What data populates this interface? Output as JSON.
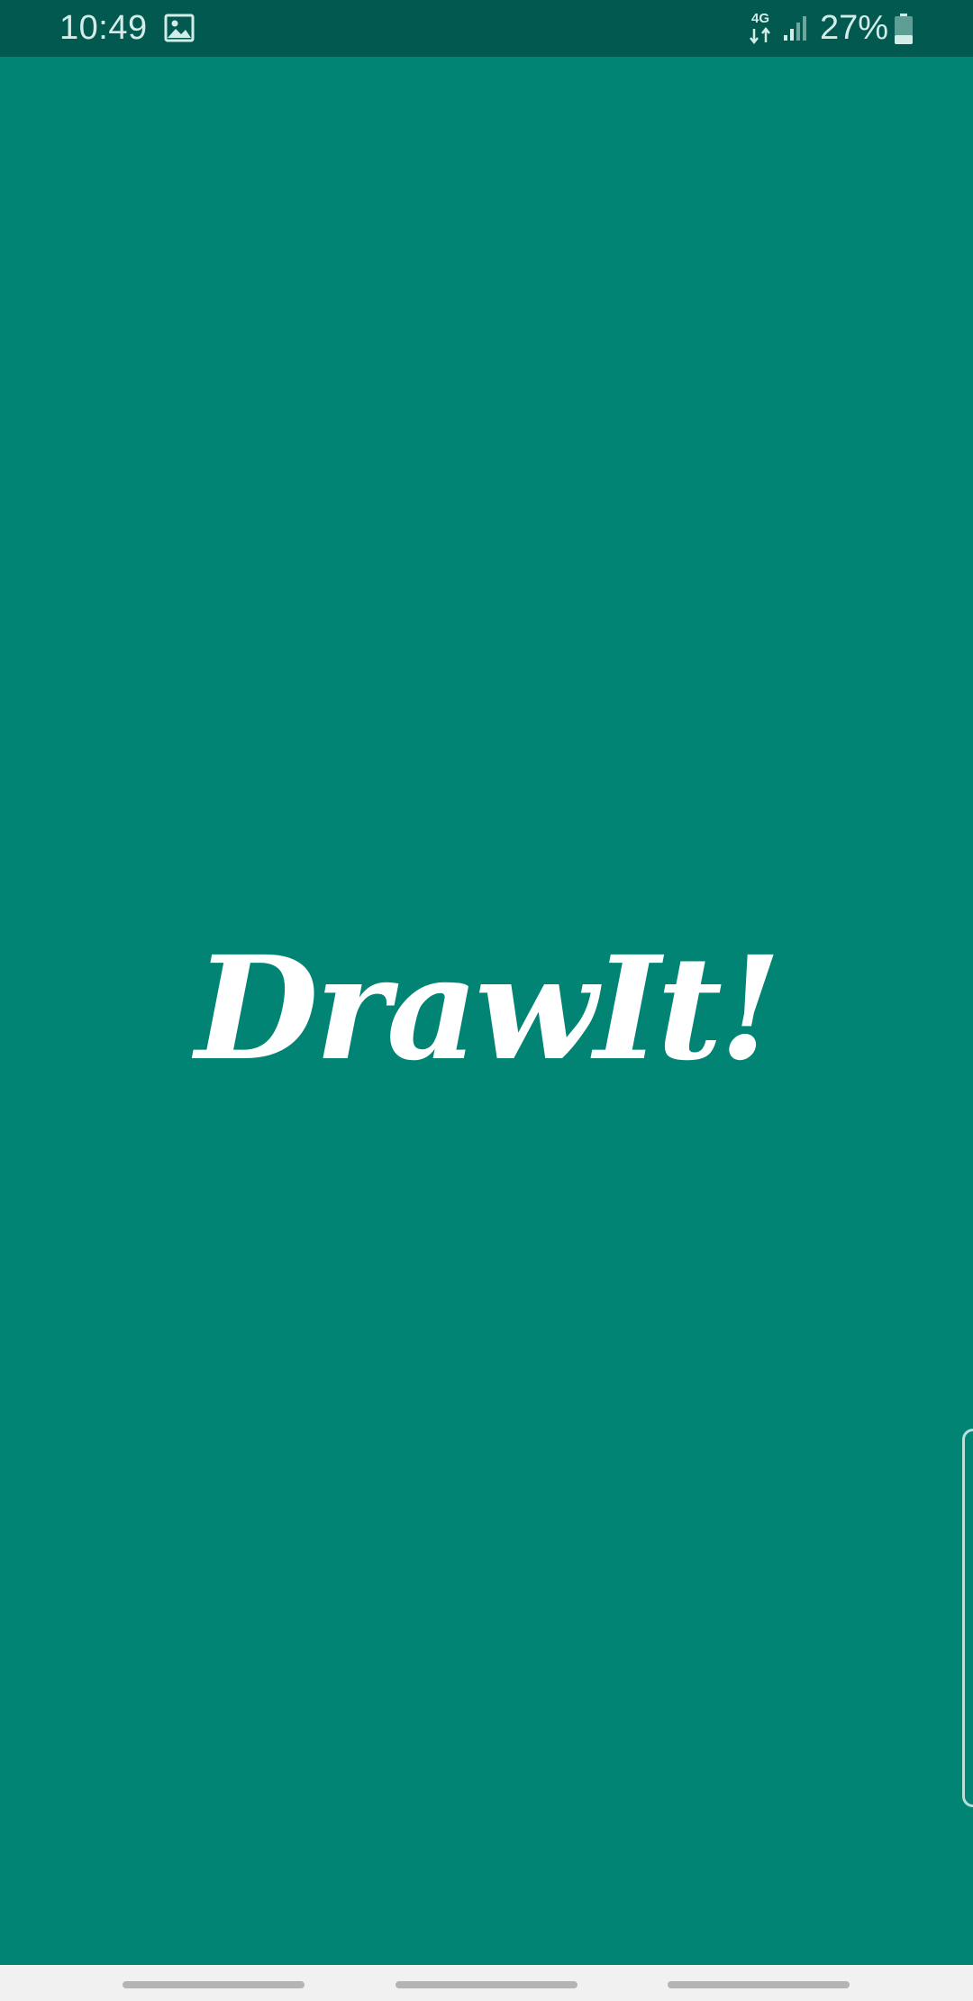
{
  "status_bar": {
    "time": "10:49",
    "network_type": "4G",
    "battery_percent": "27%",
    "battery_level": 0.27,
    "background_color": "#01594F",
    "icons": [
      "gallery-icon",
      "network-arrows-icon",
      "signal-icon",
      "battery-icon"
    ]
  },
  "splash": {
    "app_name": "DrawIt!",
    "background_color": "#028475",
    "text_color": "#FFFFFF"
  },
  "nav_bar": {
    "background_color": "#F1F1F1",
    "buttons": [
      "recent-apps",
      "home",
      "back"
    ]
  }
}
